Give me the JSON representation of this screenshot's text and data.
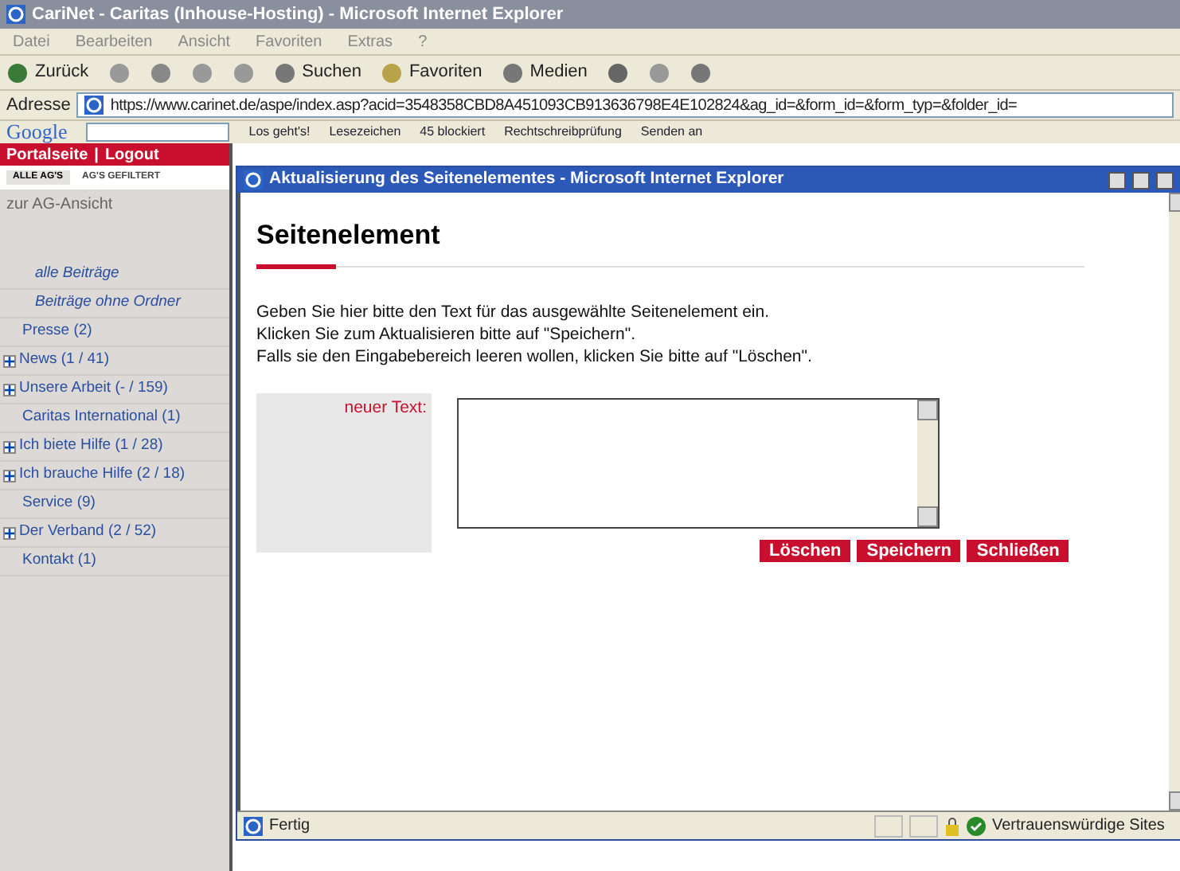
{
  "window": {
    "title": "CariNet - Caritas (Inhouse-Hosting) - Microsoft Internet Explorer"
  },
  "menu": [
    "Datei",
    "Bearbeiten",
    "Ansicht",
    "Favoriten",
    "Extras",
    "?"
  ],
  "toolbar": {
    "back": "Zurück",
    "search": "Suchen",
    "favorites": "Favoriten",
    "media": "Medien"
  },
  "address": {
    "label": "Adresse",
    "url": "https://www.carinet.de/aspe/index.asp?acid=3548358CBD8A451093CB913636798E4E102824&ag_id=&form_id=&form_typ=&folder_id="
  },
  "google_bar": {
    "logo": "Google",
    "items": [
      "Los geht's!",
      "Lesezeichen",
      "45 blockiert",
      "Rechtschreibprüfung",
      "Senden an"
    ]
  },
  "sidebar": {
    "top_links": [
      "Portalseite",
      "|",
      "Logout"
    ],
    "tabs": [
      {
        "label": "ALLE AG'S",
        "selected": true
      },
      {
        "label": "AG'S GEFILTERT",
        "selected": false
      }
    ],
    "view_link": "zur AG-Ansicht",
    "items": [
      {
        "label": "alle Beiträge",
        "kind": "italic"
      },
      {
        "label": "Beiträge ohne Ordner",
        "kind": "italic"
      },
      {
        "label": "Presse (2)",
        "kind": "plain"
      },
      {
        "label": "News (1 / 41)",
        "kind": "expandable",
        "expanded": false
      },
      {
        "label": "Unsere Arbeit (- / 159)",
        "kind": "expandable",
        "expanded": false
      },
      {
        "label": "Caritas International (1)",
        "kind": "plain"
      },
      {
        "label": "Ich biete Hilfe (1 / 28)",
        "kind": "expandable",
        "expanded": false
      },
      {
        "label": "Ich brauche Hilfe (2 / 18)",
        "kind": "expandable",
        "expanded": false
      },
      {
        "label": "Service (9)",
        "kind": "plain"
      },
      {
        "label": "Der Verband (2 / 52)",
        "kind": "expandable",
        "expanded": false
      },
      {
        "label": "Kontakt (1)",
        "kind": "plain"
      }
    ]
  },
  "popup": {
    "title": "Aktualisierung des Seitenelementes - Microsoft Internet Explorer",
    "heading": "Seitenelement",
    "instructions": [
      "Geben Sie hier bitte den Text für das ausgewählte Seitenelement ein.",
      "Klicken Sie zum Aktualisieren bitte auf \"Speichern\".",
      "Falls sie den Eingabebereich leeren wollen, klicken Sie bitte auf \"Löschen\"."
    ],
    "field_label": "neuer Text:",
    "buttons": [
      "Löschen",
      "Speichern",
      "Schließen"
    ],
    "status": {
      "text": "Fertig",
      "zone": "Vertrauenswürdige Sites"
    }
  }
}
